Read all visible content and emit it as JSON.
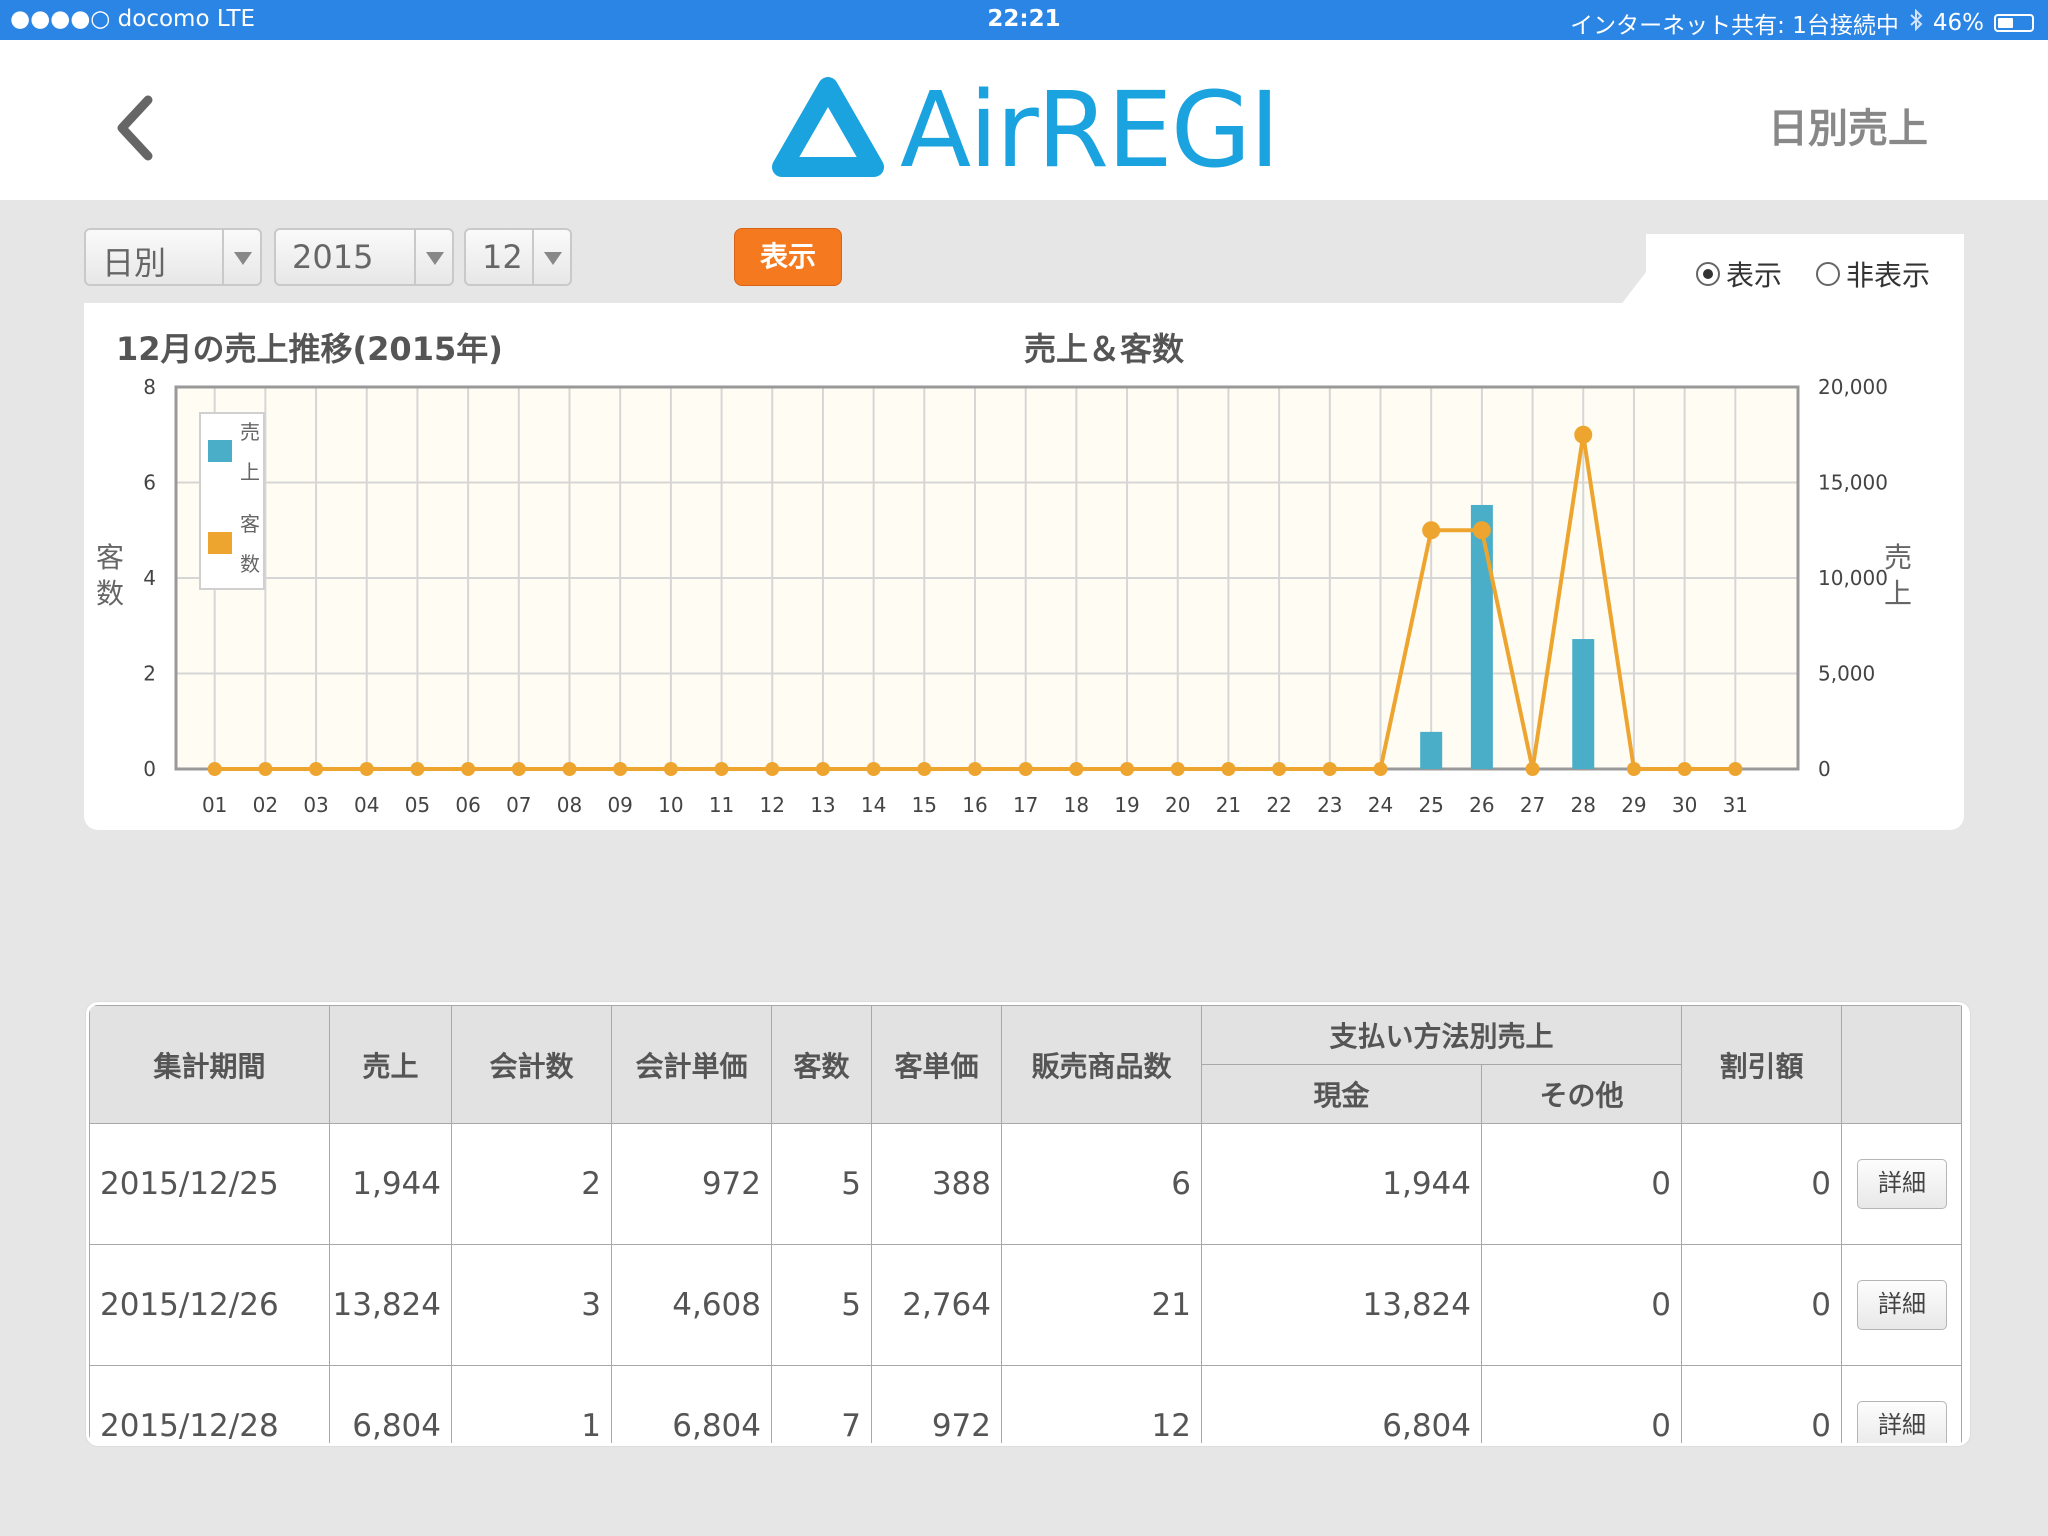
{
  "status_bar": {
    "carrier": "●●●●○ docomo  LTE",
    "time": "22:21",
    "tethering": "インターネット共有: 1台接続中",
    "battery_label": "46%",
    "battery_level": 0.46
  },
  "header": {
    "logo_text": "AirREGI",
    "title": "日別売上",
    "brand_color": "#1aa3de"
  },
  "controls": {
    "period": "日別",
    "year": "2015",
    "month": "12",
    "show_button": "表示",
    "radio_show": "表示",
    "radio_hide": "非表示",
    "radio_selected": "show"
  },
  "chart_data": {
    "type": "bar+line",
    "title": "12月の売上推移(2015年)",
    "subtitle": "売上＆客数",
    "categories": [
      "01",
      "02",
      "03",
      "04",
      "05",
      "06",
      "07",
      "08",
      "09",
      "10",
      "11",
      "12",
      "13",
      "14",
      "15",
      "16",
      "17",
      "18",
      "19",
      "20",
      "21",
      "22",
      "23",
      "24",
      "25",
      "26",
      "27",
      "28",
      "29",
      "30",
      "31"
    ],
    "series": [
      {
        "name": "売上",
        "type": "bar",
        "axis": "right",
        "color": "#4aaec8",
        "values": [
          0,
          0,
          0,
          0,
          0,
          0,
          0,
          0,
          0,
          0,
          0,
          0,
          0,
          0,
          0,
          0,
          0,
          0,
          0,
          0,
          0,
          0,
          0,
          0,
          1944,
          13824,
          0,
          6804,
          0,
          0,
          0
        ]
      },
      {
        "name": "客数",
        "type": "line",
        "axis": "left",
        "color": "#eea530",
        "values": [
          0,
          0,
          0,
          0,
          0,
          0,
          0,
          0,
          0,
          0,
          0,
          0,
          0,
          0,
          0,
          0,
          0,
          0,
          0,
          0,
          0,
          0,
          0,
          0,
          5,
          5,
          0,
          7,
          0,
          0,
          0
        ]
      }
    ],
    "left_axis": {
      "label": "客数",
      "ticks": [
        "0",
        "2",
        "4",
        "6",
        "8"
      ],
      "range": [
        0,
        8
      ]
    },
    "right_axis": {
      "label": "売上",
      "ticks": [
        "0",
        "5,000",
        "10,000",
        "15,000",
        "20,000"
      ],
      "range": [
        0,
        20000
      ]
    },
    "legend": {
      "placement": "top-left",
      "items": [
        "売上",
        "客数"
      ]
    },
    "grid": true
  },
  "table": {
    "headers": {
      "period": "集計期間",
      "sales": "売上",
      "transactions": "会計数",
      "avg_transaction": "会計単価",
      "customers": "客数",
      "avg_customer": "客単価",
      "items_sold": "販売商品数",
      "payment_group": "支払い方法別売上",
      "cash": "現金",
      "other": "その他",
      "discount": "割引額"
    },
    "rows": [
      {
        "date": "2015/12/25",
        "sales": "1,944",
        "transactions": "2",
        "avg_transaction": "972",
        "customers": "5",
        "avg_customer": "388",
        "items_sold": "6",
        "cash": "1,944",
        "other": "0",
        "discount": "0",
        "detail": "詳細"
      },
      {
        "date": "2015/12/26",
        "sales": "13,824",
        "transactions": "3",
        "avg_transaction": "4,608",
        "customers": "5",
        "avg_customer": "2,764",
        "items_sold": "21",
        "cash": "13,824",
        "other": "0",
        "discount": "0",
        "detail": "詳細"
      },
      {
        "date": "2015/12/28",
        "sales": "6,804",
        "transactions": "1",
        "avg_transaction": "6,804",
        "customers": "7",
        "avg_customer": "972",
        "items_sold": "12",
        "cash": "6,804",
        "other": "0",
        "discount": "0",
        "detail": "詳細"
      }
    ]
  }
}
